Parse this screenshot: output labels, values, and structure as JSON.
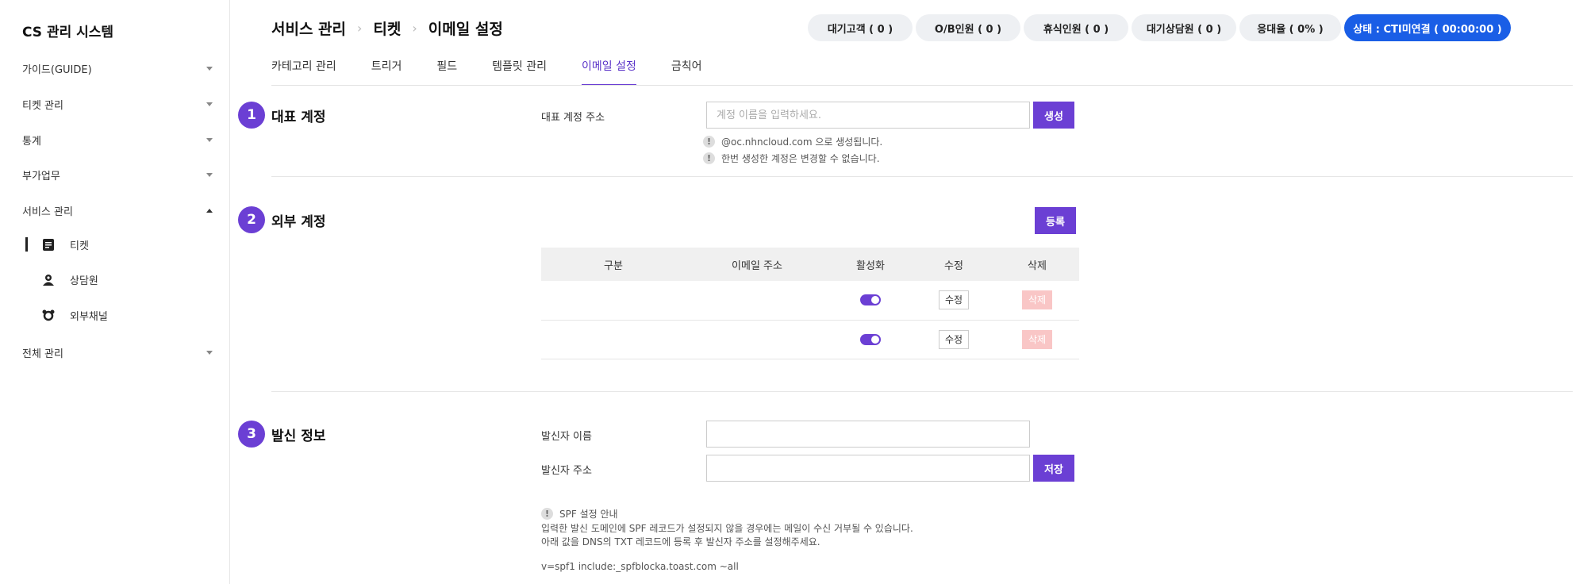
{
  "sidebar": {
    "brand": "CS 관리 시스템",
    "menu": [
      {
        "label": "가이드(GUIDE)"
      },
      {
        "label": "티켓 관리"
      },
      {
        "label": "통계"
      },
      {
        "label": "부가업무"
      },
      {
        "label": "서비스 관리"
      }
    ],
    "sub_items": [
      {
        "label": "티켓",
        "icon": "document-icon"
      },
      {
        "label": "상담원",
        "icon": "agent-icon"
      },
      {
        "label": "외부채널",
        "icon": "external-channel-icon"
      }
    ],
    "last_menu": {
      "label": "전체 관리"
    }
  },
  "header": {
    "breadcrumb": [
      "서비스 관리",
      "티켓",
      "이메일 설정"
    ],
    "stats": [
      "대기고객 ( 0 )",
      "O/B인원 ( 0 )",
      "휴식인원 ( 0 )",
      "대기상담원 ( 0 )",
      "응대율 ( 0% )"
    ],
    "status": "상태 : CTI미연결 ( 00:00:00 )"
  },
  "tabs": [
    "카테고리 관리",
    "트리거",
    "필드",
    "템플릿 관리",
    "이메일 설정",
    "금칙어"
  ],
  "active_tab": "이메일 설정",
  "section1": {
    "num": "1",
    "title": "대표 계정",
    "field_label": "대표 계정 주소",
    "placeholder": "계정 이름을 입력하세요.",
    "button": "생성",
    "notes": [
      "@oc.nhncloud.com 으로 생성됩니다.",
      "한번 생성한 계정은 변경할 수 없습니다."
    ]
  },
  "section2": {
    "num": "2",
    "title": "외부 계정",
    "button": "등록",
    "columns": [
      "구분",
      "이메일 주소",
      "활성화",
      "수정",
      "삭제"
    ],
    "rows": [
      {
        "type": "",
        "email": "",
        "enabled": true,
        "edit": "수정",
        "delete": "삭제"
      },
      {
        "type": "",
        "email": "",
        "enabled": true,
        "edit": "수정",
        "delete": "삭제"
      }
    ]
  },
  "section3": {
    "num": "3",
    "title": "발신 정보",
    "sender_name_label": "발신자 이름",
    "sender_name_value": "",
    "sender_address_label": "발신자 주소",
    "sender_address_value": "",
    "button": "저장",
    "spf_title": "SPF 설정 안내",
    "spf_line1": "입력한 발신 도메인에 SPF 레코드가 설정되지 않을 경우에는 메일이 수신 거부될 수 있습니다.",
    "spf_line2": "아래 값을 DNS의 TXT 레코드에 등록 후 발신자 주소를 설정해주세요.",
    "spf_value": "v=spf1 include:_spfblocka.toast.com ~all"
  },
  "colors": {
    "accent": "#6b3fd4",
    "status": "#1a5ee6"
  }
}
